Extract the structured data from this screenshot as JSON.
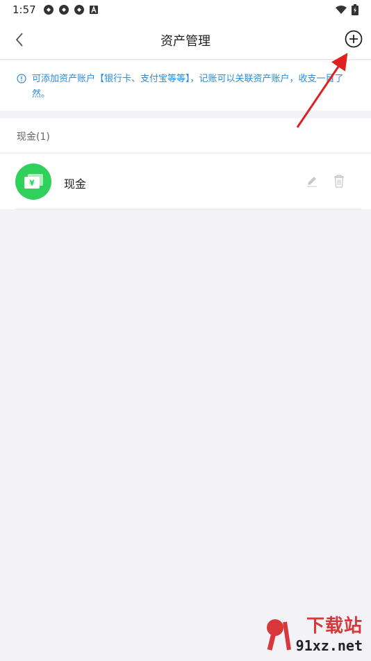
{
  "status_bar": {
    "time": "1:57",
    "left_icons": [
      "sync-icon",
      "sync-icon",
      "sync-icon",
      "a-badge-icon"
    ],
    "right_icons": [
      "wifi-icon",
      "battery-icon"
    ]
  },
  "navbar": {
    "title": "资产管理",
    "back_icon": "chevron-left-icon",
    "add_icon": "plus-circle-icon"
  },
  "notice": {
    "icon": "info-icon",
    "text": "可添加资产账户【银行卡、支付宝等等】，记账可以关联资产账户，收支一目了然。",
    "color": "#2a8bdc"
  },
  "section": {
    "header": "现金(1)"
  },
  "accounts": [
    {
      "name": "现金",
      "icon": "cash-yuan-icon",
      "icon_color": "#2fd05c"
    }
  ],
  "watermark": {
    "brand": "下载站",
    "domain": "91xz.net"
  },
  "colors": {
    "accent_red": "#e02020",
    "background": "#f2f2f7"
  }
}
